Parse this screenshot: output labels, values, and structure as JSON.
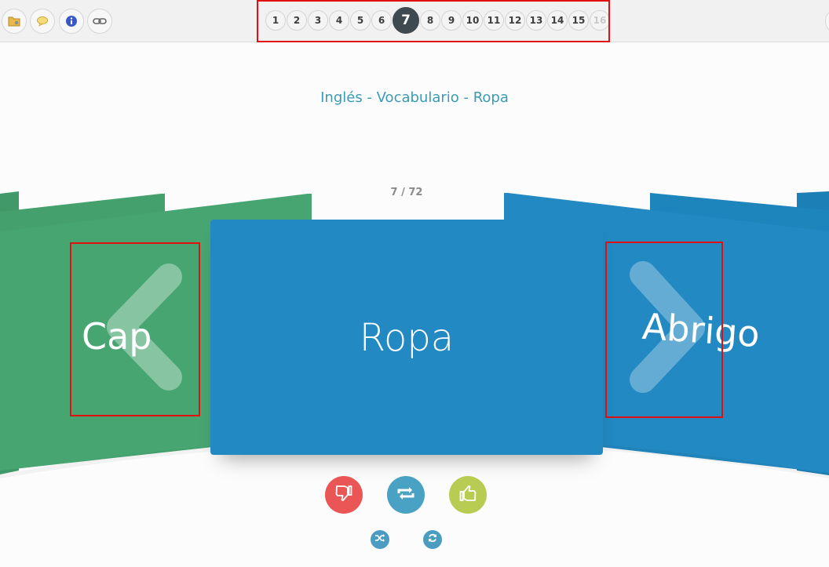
{
  "toolbar": {
    "buttons": [
      {
        "name": "folder-icon",
        "color": "#e8b94a"
      },
      {
        "name": "speech-bubble-icon",
        "color": "#f0d36a"
      },
      {
        "name": "info-icon",
        "color": "#3a58c4"
      },
      {
        "name": "link-icon",
        "color": "#777777"
      }
    ],
    "pages": [
      "1",
      "2",
      "3",
      "4",
      "5",
      "6",
      "7",
      "8",
      "9",
      "10",
      "11",
      "12",
      "13",
      "14",
      "15",
      "16"
    ],
    "current_page": "7"
  },
  "deck": {
    "title": "Inglés - Vocabulario - Ropa",
    "counter": "7 / 72"
  },
  "cards": {
    "previous_word": "Cap",
    "current_word": "Ropa",
    "next_word": "Abrigo",
    "colors": {
      "green": "#47a571",
      "blue": "#2289c2"
    }
  },
  "controls": {
    "dislike": "thumbs-down-icon",
    "repeat": "repeat-icon",
    "like": "thumbs-up-icon",
    "shuffle": "shuffle-icon",
    "reset": "refresh-icon"
  }
}
